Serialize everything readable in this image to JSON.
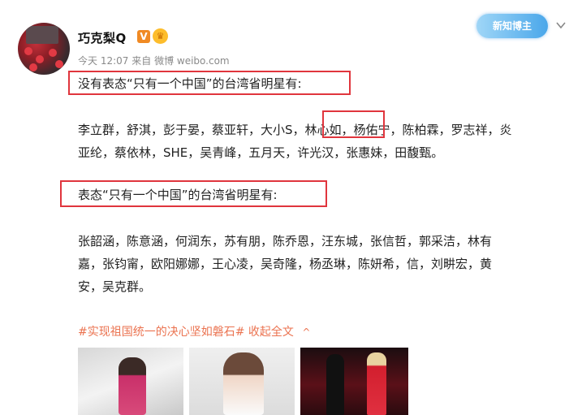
{
  "post": {
    "username": "巧克梨Q",
    "v_badge": "V",
    "crown_badge": "♛",
    "time": "今天 12:07",
    "source_prefix": "来自",
    "source": "微博 weibo.com",
    "fans_badge": "新知博主",
    "heading1": "没有表态“只有一个中国”的台湾省明星有:",
    "list1_line1": "李立群，舒淇，彭于晏，蔡亚轩，大小S，林心如，杨佑宁，陈柏霖，罗志祥，炎",
    "list1_line2": "亚纶，蔡依林，SHE，吴青峰，五月天，许光汉，张惠妹，田馥甄。",
    "heading2": "表态“只有一个中国”的台湾省明星有:",
    "list2_line1": "张韶涵，陈意涵，何润东，苏有朋，陈乔恩，汪东城，张信哲，郭采洁，林有",
    "list2_line2": "嘉，张钧甯，欧阳娜娜，王心凌，吴奇隆，杨丞琳，陈妍希，信，刘畊宏，黄",
    "list2_line3": "安，吴克群。",
    "hashtag": "#实现祖国统一的决心坚如磐石#",
    "collapse": "收起全文",
    "collapse_caret": "^"
  },
  "colors": {
    "highlight_box": "#e0353d",
    "link": "#eb7350",
    "v_badge": "#f08a24"
  }
}
